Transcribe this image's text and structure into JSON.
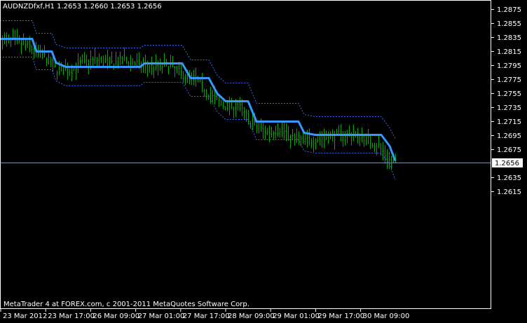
{
  "header": {
    "symbol_line": "AUDNZDfxf,H1  1.2653 1.2660 1.2653 1.2656"
  },
  "footer": {
    "copyright": "MetaTrader 4 at FOREX.com, c 2001-2011 MetaQuotes Software Corp."
  },
  "colors": {
    "background": "#000000",
    "frame": "#ffffff",
    "candles": "#00aa00",
    "mid_line": "#3399ff",
    "band": "#3366ff",
    "bid_line": "#7f8faa"
  },
  "chart_data": {
    "type": "line",
    "price_axis": {
      "ticks": [
        "1.2875",
        "1.2855",
        "1.2835",
        "1.2815",
        "1.2795",
        "1.2775",
        "1.2755",
        "1.2735",
        "1.2715",
        "1.2695",
        "1.2675",
        "1.2635",
        "1.2615"
      ],
      "ylim": [
        1.2605,
        1.2885
      ],
      "current_price": "1.2656"
    },
    "time_axis": {
      "ticks": [
        "23 Mar 2012",
        "23 Mar 17:00",
        "26 Mar 09:00",
        "27 Mar 01:00",
        "27 Mar 17:00",
        "28 Mar 09:00",
        "29 Mar 01:00",
        "29 Mar 17:00",
        "30 Mar 09:00"
      ]
    },
    "series": [
      {
        "role": "mid",
        "points": [
          [
            0,
            1.2833
          ],
          [
            46,
            1.2833
          ],
          [
            52,
            1.2815
          ],
          [
            74,
            1.2815
          ],
          [
            80,
            1.2799
          ],
          [
            94,
            1.2793
          ],
          [
            200,
            1.2793
          ],
          [
            206,
            1.2798
          ],
          [
            260,
            1.2798
          ],
          [
            272,
            1.2777
          ],
          [
            298,
            1.2777
          ],
          [
            310,
            1.2755
          ],
          [
            322,
            1.2744
          ],
          [
            354,
            1.2744
          ],
          [
            366,
            1.2715
          ],
          [
            426,
            1.2715
          ],
          [
            434,
            1.2699
          ],
          [
            450,
            1.2696
          ],
          [
            544,
            1.2696
          ],
          [
            556,
            1.268
          ],
          [
            564,
            1.2659
          ]
        ]
      },
      {
        "role": "upper",
        "points": [
          [
            0,
            1.2859
          ],
          [
            46,
            1.2859
          ],
          [
            52,
            1.2841
          ],
          [
            74,
            1.2841
          ],
          [
            80,
            1.2825
          ],
          [
            94,
            1.282
          ],
          [
            200,
            1.282
          ],
          [
            206,
            1.2824
          ],
          [
            260,
            1.2824
          ],
          [
            272,
            1.2803
          ],
          [
            298,
            1.2803
          ],
          [
            310,
            1.2781
          ],
          [
            322,
            1.277
          ],
          [
            354,
            1.277
          ],
          [
            366,
            1.2741
          ],
          [
            426,
            1.2741
          ],
          [
            434,
            1.2725
          ],
          [
            450,
            1.2722
          ],
          [
            544,
            1.2722
          ],
          [
            556,
            1.2706
          ],
          [
            564,
            1.2691
          ]
        ]
      },
      {
        "role": "lower",
        "points": [
          [
            0,
            1.2807
          ],
          [
            46,
            1.2807
          ],
          [
            52,
            1.2789
          ],
          [
            74,
            1.2789
          ],
          [
            80,
            1.2773
          ],
          [
            94,
            1.2766
          ],
          [
            200,
            1.2766
          ],
          [
            206,
            1.2771
          ],
          [
            260,
            1.2771
          ],
          [
            272,
            1.2751
          ],
          [
            298,
            1.2751
          ],
          [
            310,
            1.2729
          ],
          [
            322,
            1.2718
          ],
          [
            354,
            1.2718
          ],
          [
            366,
            1.2689
          ],
          [
            426,
            1.2689
          ],
          [
            434,
            1.2673
          ],
          [
            450,
            1.267
          ],
          [
            544,
            1.267
          ],
          [
            556,
            1.2654
          ],
          [
            564,
            1.2632
          ]
        ]
      }
    ],
    "price_path": [
      [
        0,
        1.283
      ],
      [
        20,
        1.283
      ],
      [
        40,
        1.2822
      ],
      [
        60,
        1.281
      ],
      [
        80,
        1.279
      ],
      [
        100,
        1.2788
      ],
      [
        120,
        1.28
      ],
      [
        140,
        1.2803
      ],
      [
        160,
        1.2798
      ],
      [
        180,
        1.2803
      ],
      [
        200,
        1.2795
      ],
      [
        220,
        1.2793
      ],
      [
        240,
        1.2796
      ],
      [
        260,
        1.2782
      ],
      [
        280,
        1.2775
      ],
      [
        300,
        1.2752
      ],
      [
        320,
        1.2738
      ],
      [
        340,
        1.2737
      ],
      [
        360,
        1.2712
      ],
      [
        380,
        1.27
      ],
      [
        400,
        1.2705
      ],
      [
        420,
        1.269
      ],
      [
        440,
        1.2688
      ],
      [
        460,
        1.2692
      ],
      [
        480,
        1.2695
      ],
      [
        500,
        1.2697
      ],
      [
        520,
        1.2692
      ],
      [
        540,
        1.268
      ],
      [
        556,
        1.2659
      ],
      [
        564,
        1.2656
      ]
    ]
  }
}
